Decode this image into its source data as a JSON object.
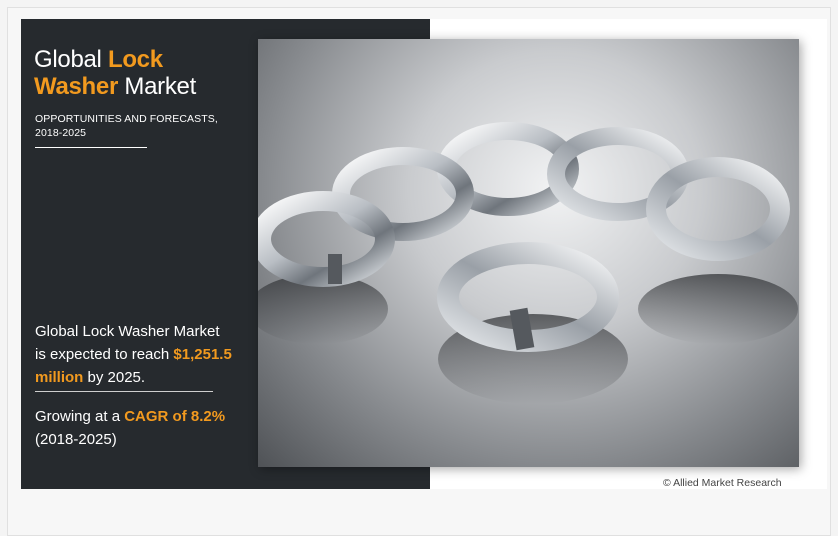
{
  "title": {
    "word1": "Global ",
    "word2": "Lock",
    "word3": "Washer",
    "word4": " Market"
  },
  "subtitle": {
    "line1": "OPPORTUNITIES AND FORECASTS,",
    "line2": "2018-2025"
  },
  "statement": {
    "line1": "Global Lock Washer Market",
    "line2_prefix": "is expected to reach ",
    "value_part1": "$1,251.5",
    "value_part2": "million",
    "suffix": " by 2025."
  },
  "growth": {
    "prefix": "Growing at a ",
    "cagr": "CAGR of 8.2%",
    "period": "(2018-2025)"
  },
  "credit": "© Allied Market Research",
  "colors": {
    "accent": "#f29a1f",
    "panel": "#262a2e"
  }
}
